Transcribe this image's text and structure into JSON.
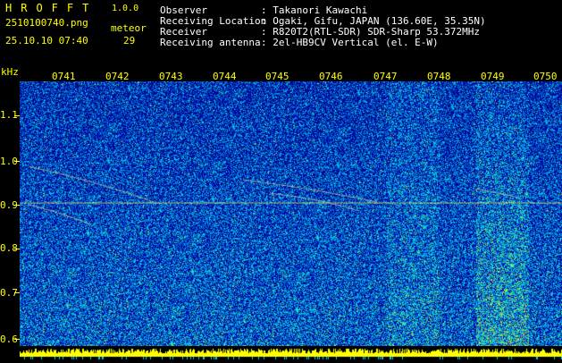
{
  "header": {
    "logo": "HROFFT",
    "version": "1.0.0",
    "filename": "2510100740.png",
    "datetime": "25.10.10 07:40",
    "meteor_label": "meteor",
    "meteor_count": "29",
    "info_labels": [
      "Observer",
      "Receiving Location",
      "Receiver",
      "Receiving antenna"
    ],
    "info_values": [
      ": Takanori Kawachi",
      ": Ogaki, Gifu, JAPAN (136.60E, 35.35N)",
      ": R820T2(RTL-SDR) SDR-Sharp 53.372MHz",
      ": 2el-HB9CV Vertical (el. E-W)"
    ]
  },
  "axes": {
    "y_unit": "kHz",
    "y_ticks": [
      "1.1",
      "1.0",
      "0.9",
      "0.8",
      "0.7",
      "0.6"
    ],
    "x_ticks": [
      "0741",
      "0742",
      "0743",
      "0744",
      "0745",
      "0746",
      "0747",
      "0748",
      "0749",
      "0750"
    ]
  },
  "colors": {
    "label": "#ffff00",
    "info": "#ffffff",
    "background": "#000000",
    "spectrogram_base": "#0010a8"
  }
}
